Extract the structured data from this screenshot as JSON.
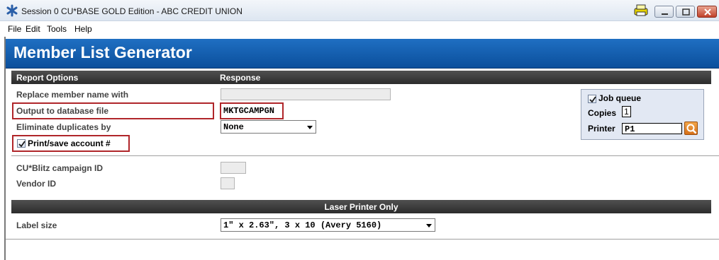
{
  "window": {
    "title": "Session 0 CU*BASE GOLD Edition - ABC CREDIT UNION",
    "app_icon": "asterisk-icon",
    "printer_indicator_icon": "printer-icon",
    "controls": [
      "minimize-icon",
      "maximize-icon",
      "close-icon"
    ]
  },
  "menu": {
    "items": [
      "File",
      "Edit",
      "Tools",
      "Help"
    ]
  },
  "page": {
    "title": "Member List Generator"
  },
  "report_options": {
    "header_left": "Report Options",
    "header_right": "Response",
    "replace_member_name": {
      "label": "Replace member name with",
      "value": ""
    },
    "output_to_db": {
      "label": "Output to database file",
      "value": "MKTGCAMPGN"
    },
    "eliminate_duplicates": {
      "label": "Eliminate duplicates by",
      "selected": "None"
    },
    "print_save_account": {
      "label": "Print/save account #",
      "checked": true
    },
    "cublitz_campaign": {
      "label": "CU*Blitz campaign ID",
      "value": ""
    },
    "vendor": {
      "label": "Vendor ID",
      "value": ""
    }
  },
  "job_panel": {
    "job_queue": {
      "label": "Job queue",
      "checked": true
    },
    "copies": {
      "label": "Copies",
      "value": "1"
    },
    "printer": {
      "label": "Printer",
      "value": "P1",
      "lookup_icon": "magnifier-icon"
    }
  },
  "laser": {
    "header": "Laser Printer Only",
    "label_size": {
      "label": "Label size",
      "selected": "1\" x 2.63\", 3 x 10 (Avery 5160)"
    }
  },
  "colors": {
    "header_blue": "#0b4f9c",
    "band_dark": "#3a3a3a",
    "highlight_red": "#b0262a",
    "panel_bg": "#e2e8f3"
  }
}
